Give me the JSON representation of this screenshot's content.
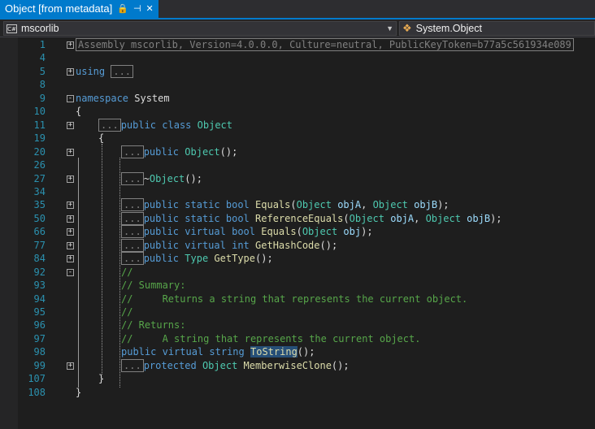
{
  "tab": {
    "title": "Object [from metadata]",
    "pin_icon": "🔒",
    "pin_glyph": "⊣",
    "close_glyph": "✕"
  },
  "navbar": {
    "assembly": "mscorlib",
    "assembly_badge": "C#",
    "type": "System.Object",
    "dropdown_glyph": "▼"
  },
  "lines": [
    {
      "num": "1",
      "fold": "+",
      "indent": 0,
      "parts": [
        {
          "t": "Assembly mscorlib, Version=4.0.0.0, Culture=neutral, PublicKeyToken=b77a5c561934e089",
          "c": "co"
        }
      ]
    },
    {
      "num": "4",
      "fold": "",
      "indent": 0,
      "parts": []
    },
    {
      "num": "5",
      "fold": "+",
      "indent": 0,
      "parts": [
        {
          "t": "using",
          "c": "kw"
        },
        {
          "t": " ",
          "c": ""
        },
        {
          "t": "...",
          "c": "co"
        }
      ]
    },
    {
      "num": "8",
      "fold": "",
      "indent": 0,
      "parts": []
    },
    {
      "num": "9",
      "fold": "-",
      "indent": 0,
      "parts": [
        {
          "t": "namespace",
          "c": "kw"
        },
        {
          "t": " System",
          "c": ""
        }
      ]
    },
    {
      "num": "10",
      "fold": "",
      "indent": 0,
      "parts": [
        {
          "t": "{",
          "c": ""
        }
      ]
    },
    {
      "num": "11",
      "fold": "+",
      "indent": 4,
      "parts": [
        {
          "t": "...",
          "c": "co"
        },
        {
          "t": "public",
          "c": "kw"
        },
        {
          "t": " ",
          "c": ""
        },
        {
          "t": "class",
          "c": "kw"
        },
        {
          "t": " ",
          "c": ""
        },
        {
          "t": "Object",
          "c": "ty"
        }
      ]
    },
    {
      "num": "19",
      "fold": "",
      "indent": 4,
      "parts": [
        {
          "t": "{",
          "c": ""
        }
      ]
    },
    {
      "num": "20",
      "fold": "+",
      "indent": 8,
      "parts": [
        {
          "t": "...",
          "c": "co"
        },
        {
          "t": "public",
          "c": "kw"
        },
        {
          "t": " ",
          "c": ""
        },
        {
          "t": "Object",
          "c": "ty"
        },
        {
          "t": "();",
          "c": ""
        }
      ]
    },
    {
      "num": "26",
      "fold": "",
      "indent": 8,
      "parts": []
    },
    {
      "num": "27",
      "fold": "+",
      "indent": 8,
      "parts": [
        {
          "t": "...",
          "c": "co"
        },
        {
          "t": "~",
          "c": ""
        },
        {
          "t": "Object",
          "c": "ty"
        },
        {
          "t": "();",
          "c": ""
        }
      ]
    },
    {
      "num": "34",
      "fold": "",
      "indent": 8,
      "parts": []
    },
    {
      "num": "35",
      "fold": "+",
      "indent": 8,
      "parts": [
        {
          "t": "...",
          "c": "co"
        },
        {
          "t": "public",
          "c": "kw"
        },
        {
          "t": " ",
          "c": ""
        },
        {
          "t": "static",
          "c": "kw"
        },
        {
          "t": " ",
          "c": ""
        },
        {
          "t": "bool",
          "c": "kw"
        },
        {
          "t": " ",
          "c": ""
        },
        {
          "t": "Equals",
          "c": "mt"
        },
        {
          "t": "(",
          "c": ""
        },
        {
          "t": "Object",
          "c": "ty"
        },
        {
          "t": " ",
          "c": ""
        },
        {
          "t": "objA",
          "c": "pr"
        },
        {
          "t": ", ",
          "c": ""
        },
        {
          "t": "Object",
          "c": "ty"
        },
        {
          "t": " ",
          "c": ""
        },
        {
          "t": "objB",
          "c": "pr"
        },
        {
          "t": ");",
          "c": ""
        }
      ]
    },
    {
      "num": "50",
      "fold": "+",
      "indent": 8,
      "parts": [
        {
          "t": "...",
          "c": "co"
        },
        {
          "t": "public",
          "c": "kw"
        },
        {
          "t": " ",
          "c": ""
        },
        {
          "t": "static",
          "c": "kw"
        },
        {
          "t": " ",
          "c": ""
        },
        {
          "t": "bool",
          "c": "kw"
        },
        {
          "t": " ",
          "c": ""
        },
        {
          "t": "ReferenceEquals",
          "c": "mt"
        },
        {
          "t": "(",
          "c": ""
        },
        {
          "t": "Object",
          "c": "ty"
        },
        {
          "t": " ",
          "c": ""
        },
        {
          "t": "objA",
          "c": "pr"
        },
        {
          "t": ", ",
          "c": ""
        },
        {
          "t": "Object",
          "c": "ty"
        },
        {
          "t": " ",
          "c": ""
        },
        {
          "t": "objB",
          "c": "pr"
        },
        {
          "t": ");",
          "c": ""
        }
      ]
    },
    {
      "num": "66",
      "fold": "+",
      "indent": 8,
      "parts": [
        {
          "t": "...",
          "c": "co"
        },
        {
          "t": "public",
          "c": "kw"
        },
        {
          "t": " ",
          "c": ""
        },
        {
          "t": "virtual",
          "c": "kw"
        },
        {
          "t": " ",
          "c": ""
        },
        {
          "t": "bool",
          "c": "kw"
        },
        {
          "t": " ",
          "c": ""
        },
        {
          "t": "Equals",
          "c": "mt"
        },
        {
          "t": "(",
          "c": ""
        },
        {
          "t": "Object",
          "c": "ty"
        },
        {
          "t": " ",
          "c": ""
        },
        {
          "t": "obj",
          "c": "pr"
        },
        {
          "t": ");",
          "c": ""
        }
      ]
    },
    {
      "num": "77",
      "fold": "+",
      "indent": 8,
      "parts": [
        {
          "t": "...",
          "c": "co"
        },
        {
          "t": "public",
          "c": "kw"
        },
        {
          "t": " ",
          "c": ""
        },
        {
          "t": "virtual",
          "c": "kw"
        },
        {
          "t": " ",
          "c": ""
        },
        {
          "t": "int",
          "c": "kw"
        },
        {
          "t": " ",
          "c": ""
        },
        {
          "t": "GetHashCode",
          "c": "mt"
        },
        {
          "t": "();",
          "c": ""
        }
      ]
    },
    {
      "num": "84",
      "fold": "+",
      "indent": 8,
      "parts": [
        {
          "t": "...",
          "c": "co"
        },
        {
          "t": "public",
          "c": "kw"
        },
        {
          "t": " ",
          "c": ""
        },
        {
          "t": "Type",
          "c": "ty"
        },
        {
          "t": " ",
          "c": ""
        },
        {
          "t": "GetType",
          "c": "mt"
        },
        {
          "t": "();",
          "c": ""
        }
      ]
    },
    {
      "num": "92",
      "fold": "-",
      "indent": 8,
      "parts": [
        {
          "t": "//",
          "c": "cm"
        }
      ]
    },
    {
      "num": "93",
      "fold": "",
      "indent": 8,
      "parts": [
        {
          "t": "// Summary:",
          "c": "cm"
        }
      ]
    },
    {
      "num": "94",
      "fold": "",
      "indent": 8,
      "parts": [
        {
          "t": "//     Returns a string that represents the current object.",
          "c": "cm"
        }
      ]
    },
    {
      "num": "95",
      "fold": "",
      "indent": 8,
      "parts": [
        {
          "t": "//",
          "c": "cm"
        }
      ]
    },
    {
      "num": "96",
      "fold": "",
      "indent": 8,
      "parts": [
        {
          "t": "// Returns:",
          "c": "cm"
        }
      ]
    },
    {
      "num": "97",
      "fold": "",
      "indent": 8,
      "parts": [
        {
          "t": "//     A string that represents the current object.",
          "c": "cm"
        }
      ]
    },
    {
      "num": "98",
      "fold": "",
      "indent": 8,
      "parts": [
        {
          "t": "public",
          "c": "kw"
        },
        {
          "t": " ",
          "c": ""
        },
        {
          "t": "virtual",
          "c": "kw"
        },
        {
          "t": " ",
          "c": ""
        },
        {
          "t": "string",
          "c": "kw"
        },
        {
          "t": " ",
          "c": ""
        },
        {
          "t": "ToString",
          "c": "mt hl"
        },
        {
          "t": "();",
          "c": ""
        }
      ]
    },
    {
      "num": "99",
      "fold": "+",
      "indent": 8,
      "parts": [
        {
          "t": "...",
          "c": "co"
        },
        {
          "t": "protected",
          "c": "kw"
        },
        {
          "t": " ",
          "c": ""
        },
        {
          "t": "Object",
          "c": "ty"
        },
        {
          "t": " ",
          "c": ""
        },
        {
          "t": "MemberwiseClone",
          "c": "mt"
        },
        {
          "t": "();",
          "c": ""
        }
      ]
    },
    {
      "num": "107",
      "fold": "",
      "indent": 4,
      "parts": [
        {
          "t": "}",
          "c": ""
        }
      ]
    },
    {
      "num": "108",
      "fold": "",
      "indent": 0,
      "parts": [
        {
          "t": "}",
          "c": ""
        }
      ]
    }
  ]
}
